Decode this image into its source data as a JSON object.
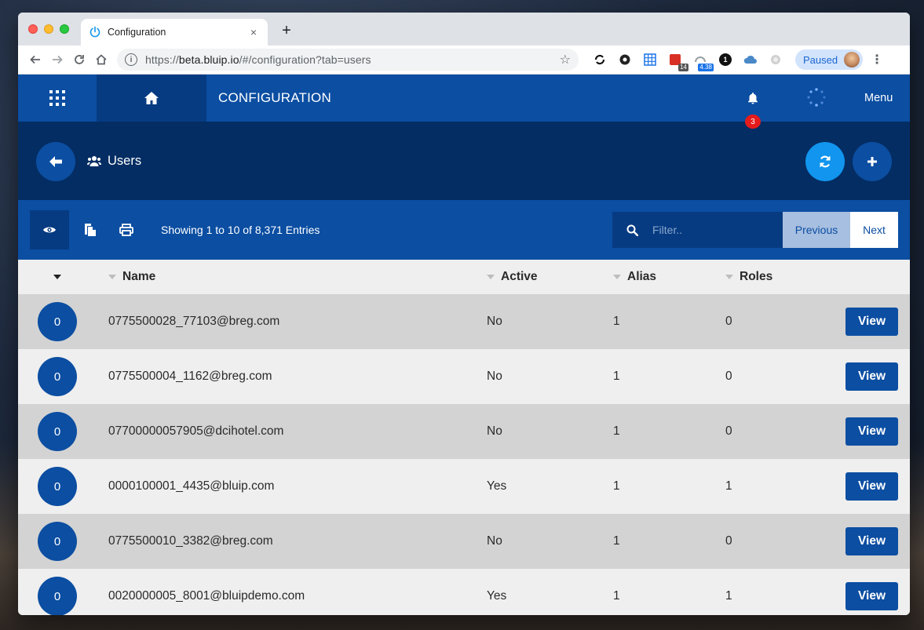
{
  "browser": {
    "tab_title": "Configuration",
    "tab_close": "×",
    "new_tab": "+",
    "url_prefix": "https://",
    "url_host": "beta.bluip.io",
    "url_path": "/#/configuration?tab=users",
    "extensions": [
      {
        "icon": "sync-icon"
      },
      {
        "icon": "puzzle-icon"
      },
      {
        "icon": "grid-extension-icon"
      },
      {
        "icon": "calendar-extension-icon",
        "badge": "14"
      },
      {
        "icon": "gauge-extension-icon",
        "badge": "4.38"
      },
      {
        "icon": "onepassword-icon",
        "label": "1"
      },
      {
        "icon": "cloud-icon"
      },
      {
        "icon": "record-icon"
      }
    ],
    "profile_label": "Paused"
  },
  "appbar": {
    "title": "CONFIGURATION",
    "notification_count": "3",
    "menu_label": "Menu"
  },
  "subbar": {
    "section": "Users"
  },
  "listbar": {
    "showing": "Showing 1 to 10 of 8,371 Entries",
    "filter_placeholder": "Filter..",
    "previous": "Previous",
    "next": "Next"
  },
  "table": {
    "headers": {
      "name": "Name",
      "active": "Active",
      "alias": "Alias",
      "roles": "Roles"
    },
    "view_label": "View",
    "rows": [
      {
        "count": "0",
        "name": "0775500028_77103@breg.com",
        "active": "No",
        "alias": "1",
        "roles": "0"
      },
      {
        "count": "0",
        "name": "0775500004_1162@breg.com",
        "active": "No",
        "alias": "1",
        "roles": "0"
      },
      {
        "count": "0",
        "name": "07700000057905@dcihotel.com",
        "active": "No",
        "alias": "1",
        "roles": "0"
      },
      {
        "count": "0",
        "name": "0000100001_4435@bluip.com",
        "active": "Yes",
        "alias": "1",
        "roles": "1"
      },
      {
        "count": "0",
        "name": "0775500010_3382@breg.com",
        "active": "No",
        "alias": "1",
        "roles": "0"
      },
      {
        "count": "0",
        "name": "0020000005_8001@bluipdemo.com",
        "active": "Yes",
        "alias": "1",
        "roles": "1"
      }
    ]
  },
  "colors": {
    "primary": "#0b4ea2",
    "primary_dark": "#063b82",
    "navy": "#042d63",
    "accent": "#1195ee",
    "badge_red": "#e51b1b"
  }
}
